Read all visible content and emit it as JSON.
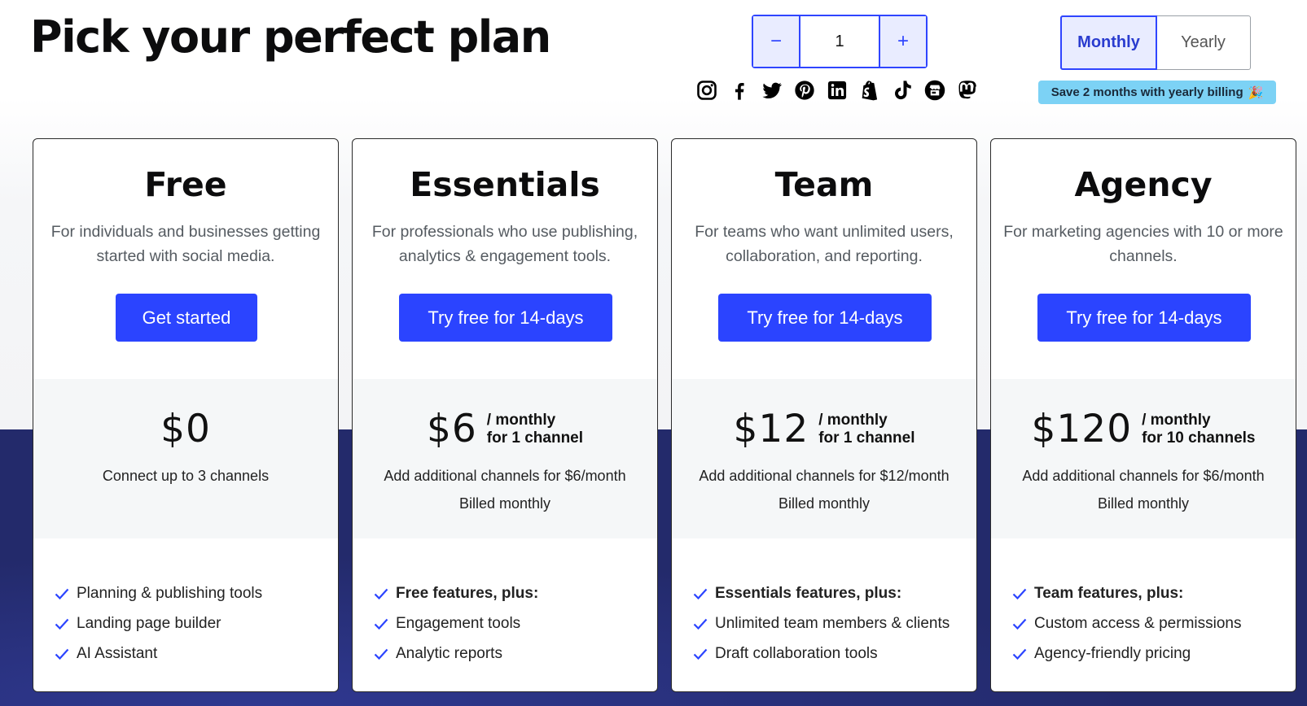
{
  "header": {
    "title": "Pick your perfect plan"
  },
  "channels_stepper": {
    "minus_label": "−",
    "value": "1",
    "plus_label": "+"
  },
  "social_icons": [
    "instagram-icon",
    "facebook-icon",
    "twitter-icon",
    "pinterest-icon",
    "linkedin-icon",
    "shopify-icon",
    "tiktok-icon",
    "google-business-icon",
    "mastodon-icon"
  ],
  "billing": {
    "options": [
      "Monthly",
      "Yearly"
    ],
    "selected": "Monthly",
    "save_badge": "Save 2 months with yearly billing",
    "save_badge_emoji": "🎉"
  },
  "colors": {
    "accent": "#2b44ff",
    "dark_band": "#232a6b",
    "badge": "#7cd2f5"
  },
  "plans": [
    {
      "name": "Free",
      "description": "For individuals and businesses getting started with social media.",
      "cta": "Get started",
      "price": "$0",
      "price_sub_1": "",
      "price_sub_2": "",
      "note_1": "Connect up to 3 channels",
      "note_2": "",
      "features": [
        "Planning & publishing tools",
        "Landing page builder",
        "AI Assistant"
      ],
      "features_first_bold": false
    },
    {
      "name": "Essentials",
      "description": "For professionals who use publishing, analytics & engagement tools.",
      "cta": "Try free for 14-days",
      "price": "$6",
      "price_sub_1": "/ monthly",
      "price_sub_2": "for 1 channel",
      "note_1": "Add additional channels for $6/month",
      "note_2": "Billed monthly",
      "features": [
        "Free features, plus:",
        "Engagement tools",
        "Analytic reports"
      ],
      "features_first_bold": true
    },
    {
      "name": "Team",
      "description": "For teams who want unlimited users, collaboration, and reporting.",
      "cta": "Try free for 14-days",
      "price": "$12",
      "price_sub_1": "/ monthly",
      "price_sub_2": "for 1 channel",
      "note_1": "Add additional channels for $12/month",
      "note_2": "Billed monthly",
      "features": [
        "Essentials features, plus:",
        "Unlimited team members & clients",
        "Draft collaboration tools"
      ],
      "features_first_bold": true
    },
    {
      "name": "Agency",
      "description": "For marketing agencies with 10 or more channels.",
      "cta": "Try free for 14-days",
      "price": "$120",
      "price_sub_1": "/ monthly",
      "price_sub_2": "for 10 channels",
      "note_1": "Add additional channels for $6/month",
      "note_2": "Billed monthly",
      "features": [
        "Team features, plus:",
        "Custom access & permissions",
        "Agency-friendly pricing"
      ],
      "features_first_bold": true
    }
  ]
}
